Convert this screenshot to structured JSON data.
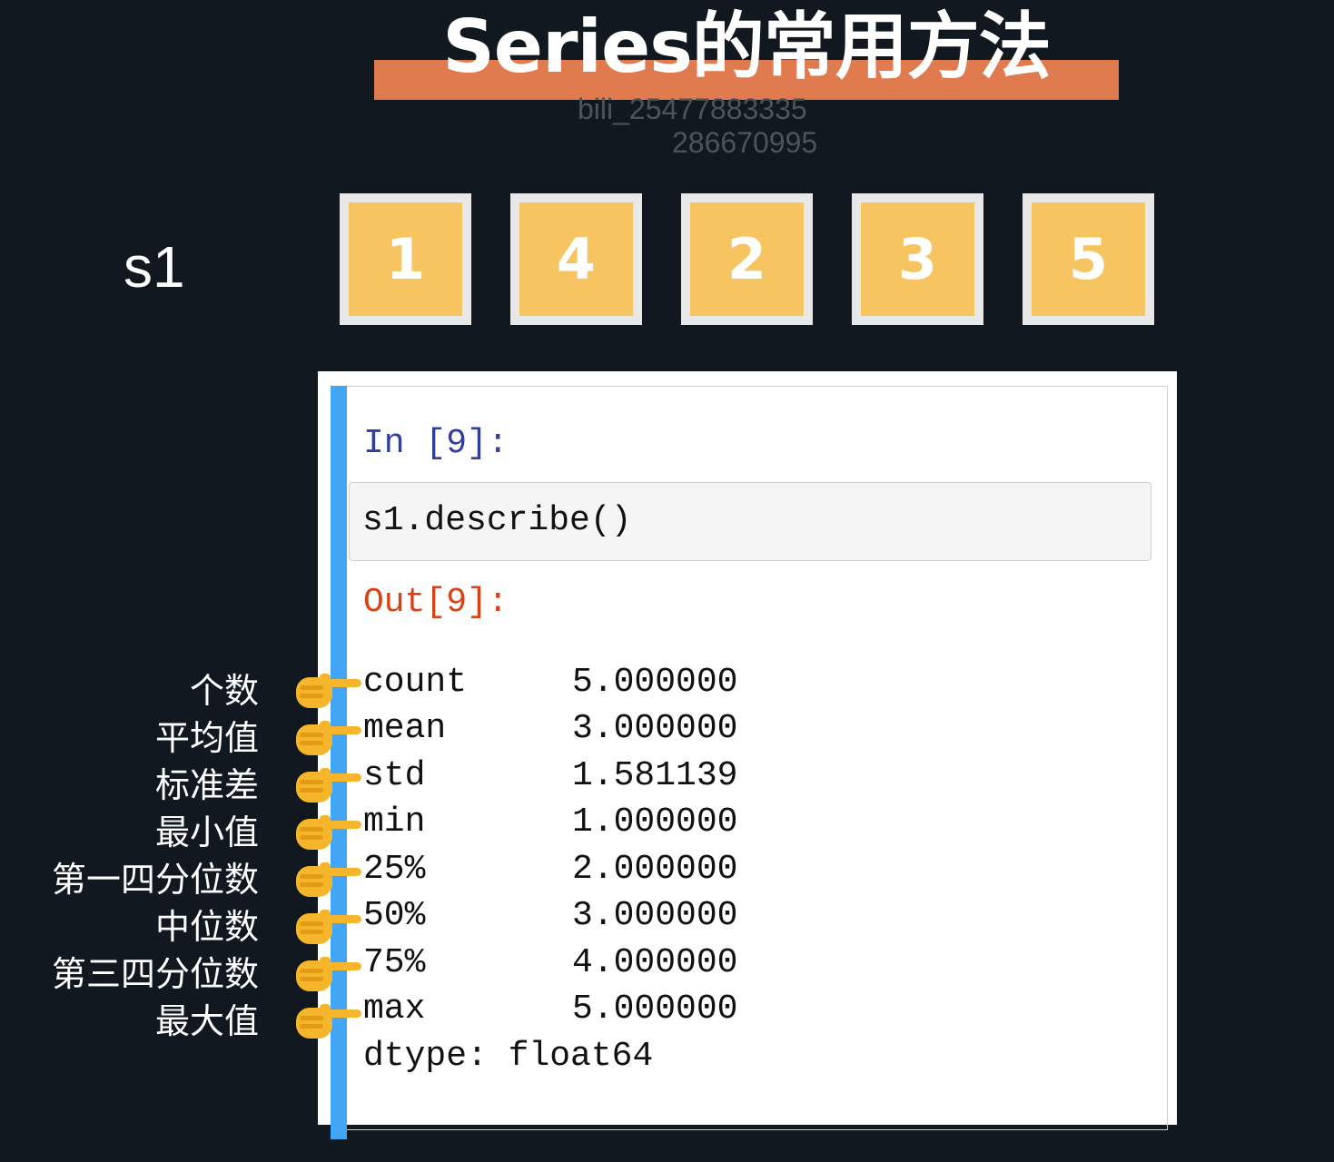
{
  "title": "Series的常用方法",
  "watermark": {
    "line1": "bili_25477883335",
    "line2": "286670995"
  },
  "series": {
    "label": "s1",
    "values": [
      "1",
      "4",
      "2",
      "3",
      "5"
    ]
  },
  "notebook": {
    "in_prompt": "In [9]:",
    "code": "s1.describe()",
    "out_prompt": "Out[9]:",
    "rows": [
      {
        "key": "count",
        "value": "5.000000",
        "note": "个数"
      },
      {
        "key": "mean",
        "value": "3.000000",
        "note": "平均值"
      },
      {
        "key": "std",
        "value": "1.581139",
        "note": "标准差"
      },
      {
        "key": "min",
        "value": "1.000000",
        "note": "最小值"
      },
      {
        "key": "25%",
        "value": "2.000000",
        "note": "第一四分位数"
      },
      {
        "key": "50%",
        "value": "3.000000",
        "note": "中位数"
      },
      {
        "key": "75%",
        "value": "4.000000",
        "note": "第三四分位数"
      },
      {
        "key": "max",
        "value": "5.000000",
        "note": "最大值"
      }
    ],
    "dtype_line": "dtype: float64"
  },
  "icons": {
    "pointer": "pointing-hand-icon"
  },
  "colors": {
    "background": "#111820",
    "title_bar": "#e07a4f",
    "cell_fill": "#f7c462",
    "active_cell_bar": "#42a5f5",
    "in_prompt": "#303f9f",
    "out_prompt": "#d84315"
  }
}
